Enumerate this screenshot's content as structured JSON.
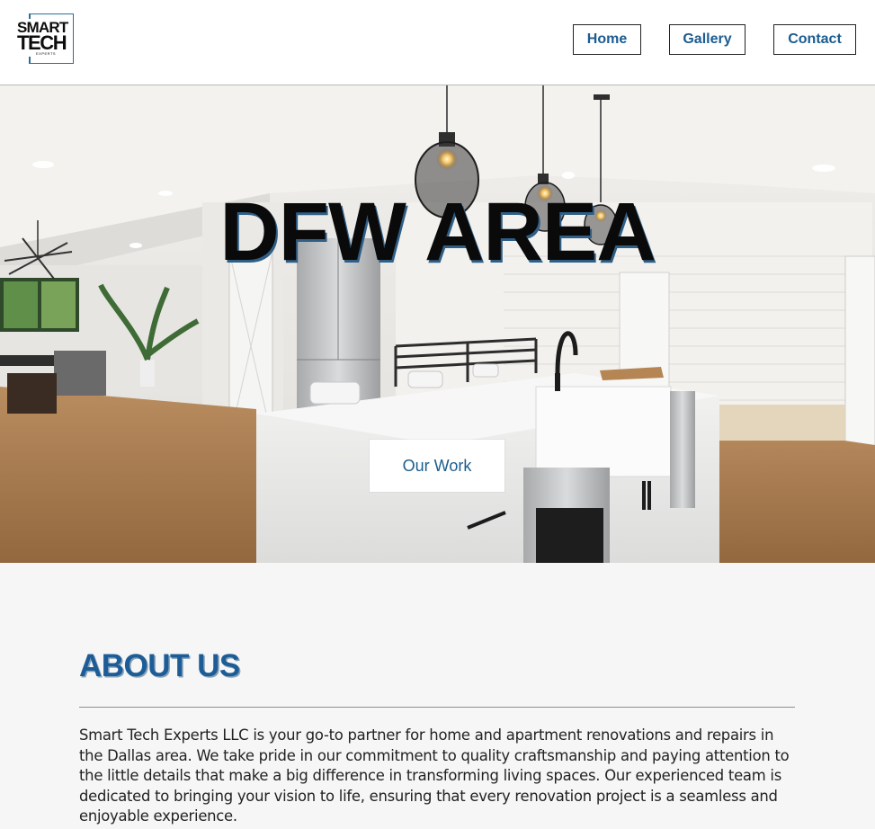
{
  "logo": {
    "line1": "SMART",
    "line2": "TECH",
    "line3": "EXPERTS",
    "frame_color": "#2b6f95"
  },
  "nav": {
    "items": [
      {
        "label": "Home"
      },
      {
        "label": "Gallery"
      },
      {
        "label": "Contact"
      }
    ],
    "text_color": "#1b5c91"
  },
  "hero": {
    "title": "DFW AREA",
    "cta_label": "Our Work",
    "image": "kitchen-interior-photo"
  },
  "about": {
    "heading": "ABOUT US",
    "body": "Smart Tech Experts LLC is your go-to partner for home and apartment renovations and repairs in the Dallas area. We take pride in our commitment to quality craftsmanship and paying attention to the little details that make a big difference in transforming living spaces. Our experienced team is dedicated to bringing your vision to life, ensuring that every renovation project is a seamless and enjoyable experience.",
    "heading_color": "#1d5d97"
  }
}
